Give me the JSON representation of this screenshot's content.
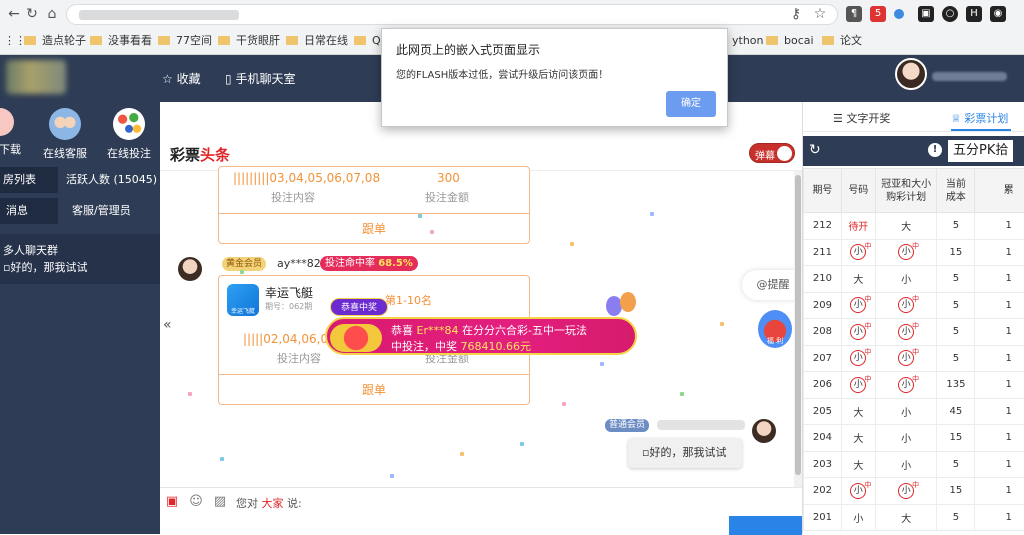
{
  "browser": {
    "icons": [
      "back-icon",
      "forward-icon",
      "reload-icon",
      "home-icon",
      "key-icon",
      "star-icon"
    ],
    "bookmarks": [
      {
        "label": "造点轮子"
      },
      {
        "label": "没事看看"
      },
      {
        "label": "77空间"
      },
      {
        "label": "干货眼肝"
      },
      {
        "label": "日常在线"
      },
      {
        "label": "Q"
      },
      {
        "label": "ython"
      },
      {
        "label": "bocai"
      },
      {
        "label": "论文"
      }
    ]
  },
  "header": {
    "favorite": "收藏",
    "mobile_chat": "手机聊天室"
  },
  "sidebar": {
    "tools": [
      {
        "label": "下载"
      },
      {
        "label": "在线客服"
      },
      {
        "label": "在线投注"
      }
    ],
    "tabs_row1": [
      "房列表",
      "活跃人数 (15045)"
    ],
    "tabs_row2": [
      "消息",
      "客服/管理员"
    ],
    "group": {
      "name": "多人聊天群",
      "last_message": "好的，那我试试"
    }
  },
  "chat": {
    "brand_black": "彩票",
    "brand_red": "头条",
    "toggle_label": "弹幕",
    "card1": {
      "numbers": "|||||||||03,04,05,06,07,08",
      "amount": "300",
      "content_label": "投注内容",
      "amount_label": "投注金额",
      "follow_label": "跟单"
    },
    "post2": {
      "badge": "黄金会员",
      "user": "ay***82",
      "rate_label": "投注命中率",
      "rate_value": "68.5%"
    },
    "card2": {
      "game": "幸运飞艇",
      "game_logo_text": "幸运飞艇",
      "period": "期号：062期",
      "position": "第1-10名",
      "numbers": "|||||02,04,06,08",
      "content_label": "投注内容",
      "amount_label": "投注金额",
      "follow_label": "跟单"
    },
    "win_banner": {
      "ribbon": "恭喜中奖",
      "line1_prefix": "恭喜",
      "user": "Er***84",
      "line1_suffix": "在分分六合彩-五中一玩法",
      "line2_prefix": "中投注，中奖",
      "amount": "768410.66元"
    },
    "remind_label": "@提醒",
    "welfare_label": "福 利",
    "my_post": {
      "badge": "普通会员",
      "message": "好的，那我试试"
    },
    "input": {
      "label_prefix": "您对",
      "target": "大家",
      "label_suffix": "说:"
    }
  },
  "right_panel": {
    "tabs": [
      "文字开奖",
      "彩票计划"
    ],
    "lottery": "五分PK拾",
    "headers": [
      "期号",
      "号码",
      "冠亚和大小购彩计划",
      "当前成本",
      "累"
    ],
    "rows": [
      {
        "period": "212",
        "number": "待开",
        "plan": "大",
        "cost": "5",
        "total": "1"
      },
      {
        "period": "211",
        "number": "小",
        "plan": "小",
        "cost": "15",
        "total": "1"
      },
      {
        "period": "210",
        "number": "大",
        "plan": "小",
        "cost": "5",
        "total": "1"
      },
      {
        "period": "209",
        "number": "小",
        "plan": "小",
        "cost": "5",
        "total": "1"
      },
      {
        "period": "208",
        "number": "小",
        "plan": "小",
        "cost": "5",
        "total": "1"
      },
      {
        "period": "207",
        "number": "小",
        "plan": "小",
        "cost": "5",
        "total": "1"
      },
      {
        "period": "206",
        "number": "小",
        "plan": "小",
        "cost": "135",
        "total": "1"
      },
      {
        "period": "205",
        "number": "大",
        "plan": "小",
        "cost": "45",
        "total": "1"
      },
      {
        "period": "204",
        "number": "大",
        "plan": "小",
        "cost": "15",
        "total": "1"
      },
      {
        "period": "203",
        "number": "大",
        "plan": "小",
        "cost": "5",
        "total": "1"
      },
      {
        "period": "202",
        "number": "小",
        "plan": "小",
        "cost": "15",
        "total": "1"
      },
      {
        "period": "201",
        "number": "小",
        "plan": "大",
        "cost": "5",
        "total": "1"
      }
    ],
    "hit_mark": "中"
  },
  "dialog": {
    "title": "此网页上的嵌入式页面显示",
    "message": "您的FLASH版本过低，尝试升级后访问该页面！",
    "ok": "确定"
  }
}
